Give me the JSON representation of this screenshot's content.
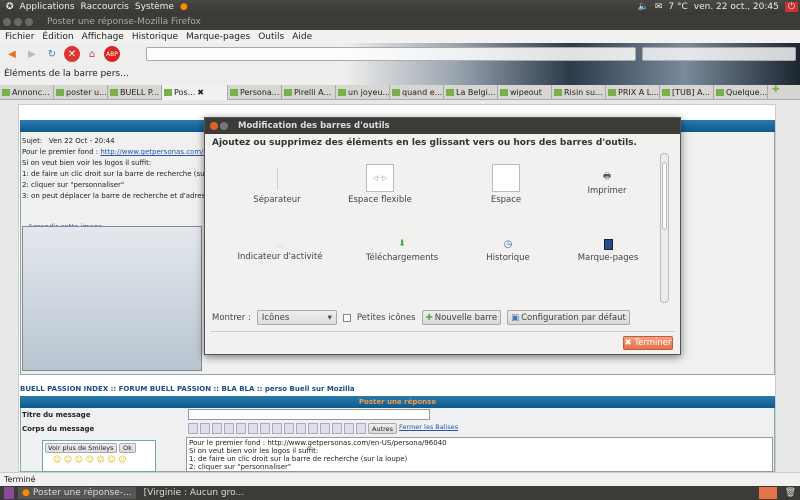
{
  "panel": {
    "applications": "Applications",
    "shortcuts": "Raccourcis",
    "system": "Système",
    "temperature": "7 °C",
    "datetime": "ven. 22 oct., 20:45"
  },
  "window": {
    "title": "Poster une réponse-Mozilla Firefox"
  },
  "menu": [
    "Fichier",
    "Édition",
    "Affichage",
    "Historique",
    "Marque-pages",
    "Outils",
    "Aide"
  ],
  "bookmarks": {
    "item": "Éléments de la barre pers..."
  },
  "tabs": [
    "Annonc...",
    "poster u...",
    "BUELL P...",
    "Pos...",
    "Persona...",
    "Pirelli A...",
    "un joyeu...",
    "quand e...",
    "La Belgi...",
    "wipeout",
    "Risin su...",
    "PRIX A L...",
    "[TUB] A...",
    "Quelque..."
  ],
  "active_tab": 3,
  "post": {
    "subject_label": "Sujet:",
    "date": "Ven 22 Oct - 20:44",
    "lines": [
      "Pour le premier fond : ",
      "Si on veut bien voir les logos il suffit:",
      "1: de faire un clic droit sur la barre de recherche (sur la loupe)",
      "2: cliquer sur \"personnaliser\"",
      "3: on peut déplacer la barre de recherche et d'adresse"
    ],
    "link": "http://www.getpersonas.com/en-US/persona/96040",
    "enlarge": "Agrandir cette image"
  },
  "breadcrumb": "BUELL PASSION INDEX  :: FORUM BUELL PASSION :: BLA BLA :: perso Buell sur Mozilla",
  "reply": {
    "header": "Poster une réponse",
    "title_label": "Titre du message",
    "body_label": "Corps du message",
    "smileys_select": "Voir plus de Smileys",
    "ok": "Ok",
    "others": "Autres",
    "close_tags": "Fermer les Balises",
    "message_lines": [
      "Pour le premier fond : http://www.getpersonas.com/en-US/persona/96040",
      "Si on veut bien voir les logos il suffit:",
      "1: de faire un clic droit sur la barre de recherche (sur la loupe)",
      "2: cliquer sur \"personnaliser\""
    ]
  },
  "status": "Terminé",
  "taskbar": [
    "Poster une réponse-...",
    "[Virginie : Aucun gro..."
  ],
  "dialog": {
    "title": "Modification des barres d'outils",
    "instructions": "Ajoutez ou supprimez des éléments en les glissant vers ou hors des barres d'outils.",
    "items": [
      "Séparateur",
      "Espace flexible",
      "Espace",
      "Imprimer",
      "Indicateur d'activité",
      "Téléchargements",
      "Historique",
      "Marque-pages"
    ],
    "show_label": "Montrer :",
    "show_value": "Icônes",
    "small_icons": "Petites icônes",
    "small_icons_checked": false,
    "new_bar": "Nouvelle barre",
    "default_config": "Configuration par défaut",
    "done": "Terminer"
  },
  "colors": {
    "accent_header": "#0d5a8a",
    "reply_header_text": "#f39a4a",
    "done_button": "#e8704a"
  }
}
